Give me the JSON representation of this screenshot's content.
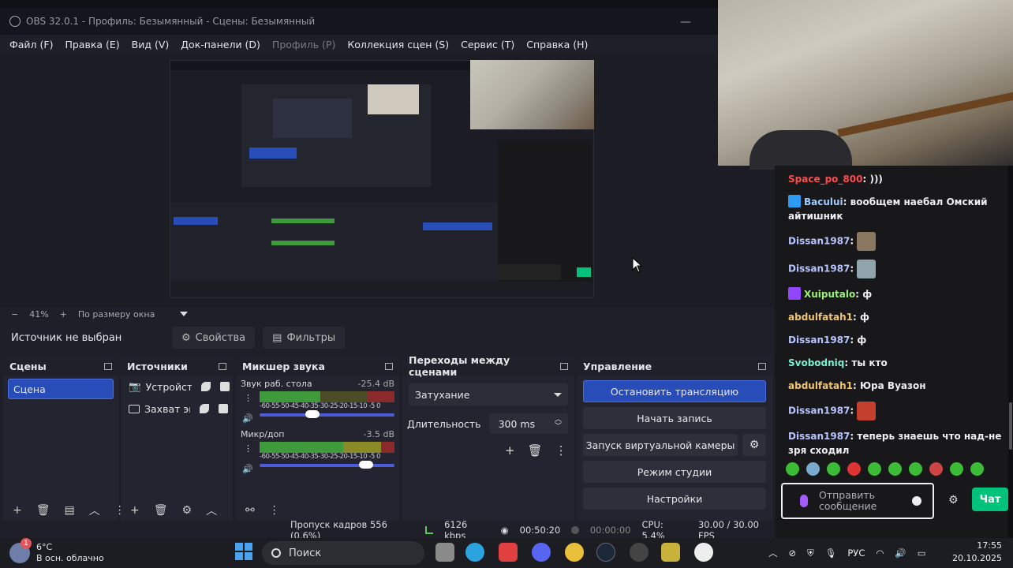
{
  "window": {
    "title": "OBS 32.0.1 - Профиль: Безымянный - Сцены: Безымянный"
  },
  "menu": [
    {
      "label": "Файл (F)",
      "enabled": true
    },
    {
      "label": "Правка (E)",
      "enabled": true
    },
    {
      "label": "Вид (V)",
      "enabled": true
    },
    {
      "label": "Док-панели (D)",
      "enabled": true
    },
    {
      "label": "Профиль (P)",
      "enabled": false
    },
    {
      "label": "Коллекция сцен (S)",
      "enabled": true
    },
    {
      "label": "Сервис (T)",
      "enabled": true
    },
    {
      "label": "Справка (H)",
      "enabled": true
    }
  ],
  "zoom": {
    "minus": "−",
    "value": "41%",
    "plus": "+",
    "mode": "По размеру окна"
  },
  "source_bar": {
    "status": "Источник не выбран",
    "properties_label": "Свойства",
    "filters_label": "Фильтры"
  },
  "scenes": {
    "title": "Сцены",
    "items": [
      "Сцена"
    ]
  },
  "sources": {
    "title": "Источники",
    "items": [
      "Устройств",
      "Захват эк"
    ]
  },
  "mixer": {
    "title": "Микшер звука",
    "channels": [
      {
        "name": "Звук раб. стола",
        "db": "-25.4 dB",
        "level": 0.45
      },
      {
        "name": "Микр/доп",
        "db": "-3.5 dB",
        "level": 0.9
      }
    ],
    "ticks": "-60-55-50-45-40-35-30-25-20-15-10 -5  0"
  },
  "transitions": {
    "title": "Переходы между сценами",
    "selected": "Затухание",
    "duration_label": "Длительность",
    "duration_value": "300 ms"
  },
  "controls": {
    "title": "Управление",
    "stop_stream": "Остановить трансляцию",
    "start_record": "Начать запись",
    "virtual_cam": "Запуск виртуальной камеры",
    "studio_mode": "Режим студии",
    "settings": "Настройки"
  },
  "status": {
    "dropped": "Пропуск кадров 556 (0.6%)",
    "bitrate": "6126 kbps",
    "stream_time": "00:50:20",
    "rec_time": "00:00:00",
    "cpu": "CPU: 5.4%",
    "fps": "30.00 / 30.00 FPS"
  },
  "chat": {
    "messages": [
      {
        "user": "Space_po_800",
        "color": "#ff4b4b",
        "text": ")))",
        "badge": null
      },
      {
        "user": "Bacului",
        "color": "#9ecbff",
        "text": "вообщем наебал Омский айтишник",
        "badge": "#2b9bf4"
      },
      {
        "user": "Dissan1987",
        "color": "#b9c4ff",
        "text": "",
        "emote": "#8a7760"
      },
      {
        "user": "Dissan1987",
        "color": "#b9c4ff",
        "text": "",
        "emote": "#8fa4ad"
      },
      {
        "user": "Xuiputalo",
        "color": "#9ef07a",
        "text": "ф",
        "badge": "#9146ff"
      },
      {
        "user": "abdulfatah1",
        "color": "#f0c674",
        "text": "ф"
      },
      {
        "user": "Dissan1987",
        "color": "#b9c4ff",
        "text": "ф"
      },
      {
        "user": "Svobodniq",
        "color": "#7af0d0",
        "text": "ты кто"
      },
      {
        "user": "abdulfatah1",
        "color": "#f0c674",
        "text": "Юра Вуазон"
      },
      {
        "user": "Dissan1987",
        "color": "#b9c4ff",
        "text": "",
        "emote": "#c3402e"
      },
      {
        "user": "Dissan1987",
        "color": "#b9c4ff",
        "text": "теперь знаешь что над-не зря сходил"
      }
    ],
    "input_placeholder": "Отправить сообщение",
    "send_label": "Чат"
  },
  "taskbar": {
    "weather_temp": "6°C",
    "weather_desc": "В осн. облачно",
    "notif_count": "1",
    "search_placeholder": "Поиск",
    "lang": "РУС",
    "time": "17:55",
    "date": "20.10.2025"
  }
}
